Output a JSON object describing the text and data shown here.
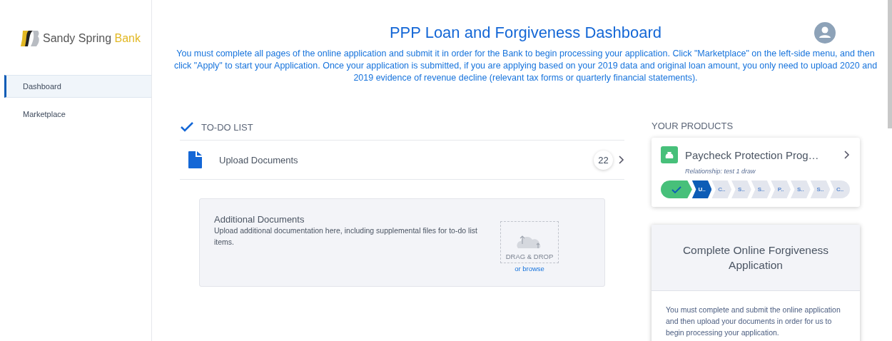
{
  "sidebar": {
    "brand": {
      "name": "Sandy Spring",
      "accent": "Bank"
    },
    "items": [
      {
        "label": "Dashboard",
        "selected": true
      },
      {
        "label": "Marketplace",
        "selected": false
      }
    ]
  },
  "header": {
    "title": "PPP Loan and Forgiveness Dashboard",
    "intro": "You must complete all pages of the online application and submit it in order for the Bank to begin processing your application. Click \"Marketplace\" on the left-side menu, and then click \"Apply\" to start your Application. Once your application is submitted, if you are applying based on your 2019 data and original loan amount, you only need to upload 2020 and 2019 evidence of revenue decline (relevant tax forms or quarterly financial statements)."
  },
  "todo": {
    "title": "TO-DO LIST",
    "items": [
      {
        "label": "Upload Documents",
        "count": "22"
      }
    ]
  },
  "additional": {
    "title": "Additional Documents",
    "text": "Upload additional documentation here, including supplemental files for to-do list items.",
    "drop_label": "DRAG & DROP",
    "browse": "or browse"
  },
  "products": {
    "title": "YOUR PRODUCTS",
    "card": {
      "name": "Paycheck Protection Prog…",
      "relationship": "Relationship: test 1 draw",
      "steps": [
        {
          "kind": "done"
        },
        {
          "kind": "current",
          "label": "U.."
        },
        {
          "kind": "pending",
          "label": "C.."
        },
        {
          "kind": "pending",
          "label": "S.."
        },
        {
          "kind": "pending",
          "label": "S.."
        },
        {
          "kind": "pending",
          "label": "P.."
        },
        {
          "kind": "pending",
          "label": "S.."
        },
        {
          "kind": "pending",
          "label": "S.."
        },
        {
          "kind": "pending",
          "label": "C.."
        }
      ]
    }
  },
  "forgiveness": {
    "title": "Complete Online Forgiveness Application",
    "text": "You must complete and submit the online application and then upload your documents in order for us to begin processing your application."
  }
}
